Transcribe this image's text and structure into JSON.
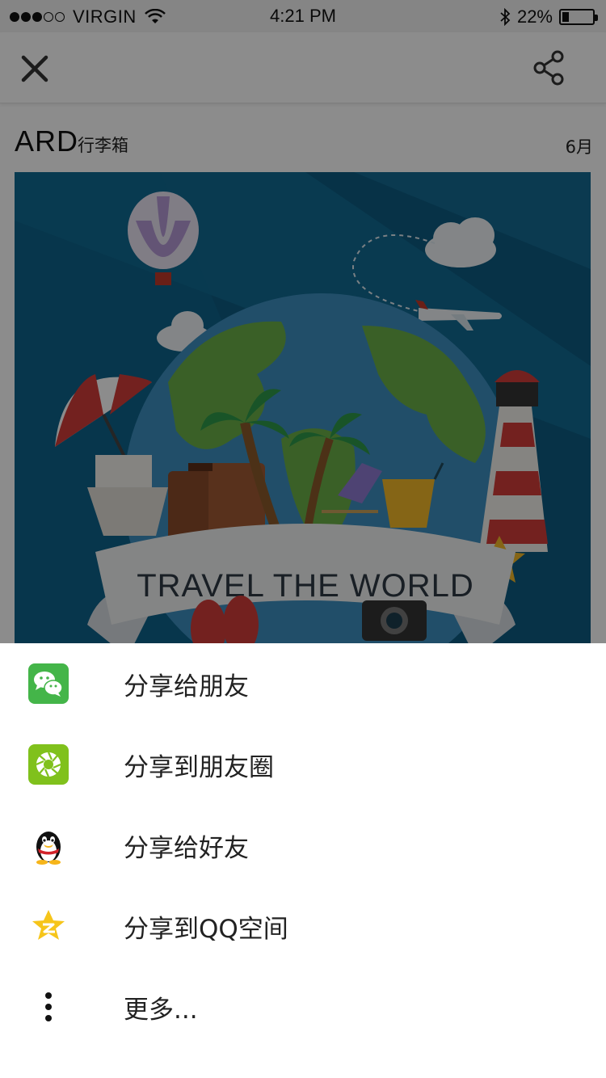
{
  "status_bar": {
    "carrier": "VIRGIN",
    "time": "4:21 PM",
    "battery_text": "22%",
    "battery_level": 0.22,
    "signal_bars_filled": 3,
    "signal_bars_total": 5
  },
  "navbar": {
    "close_icon": "close-icon",
    "share_icon": "share-icon"
  },
  "article": {
    "brand": "ARD",
    "brand_sub": "行李箱",
    "month": "6月",
    "poster_text": "TRAVEL THE WORLD"
  },
  "share_sheet": {
    "items": [
      {
        "label": "分享给朋友",
        "icon": "wechat-icon",
        "color": "#44b549"
      },
      {
        "label": "分享到朋友圈",
        "icon": "moments-icon",
        "color": "#80c11c"
      },
      {
        "label": "分享给好友",
        "icon": "qq-icon",
        "color": "#000000"
      },
      {
        "label": "分享到QQ空间",
        "icon": "qzone-icon",
        "color": "#f6c51a"
      },
      {
        "label": "更多...",
        "icon": "more-icon",
        "color": "#111111"
      }
    ]
  },
  "colors": {
    "overlay": "rgba(0,0,0,0.45)",
    "poster_bg": "#0e5c82",
    "wechat_green": "#44b549",
    "moments_green": "#80c11c",
    "qzone_yellow": "#f6c51a"
  }
}
